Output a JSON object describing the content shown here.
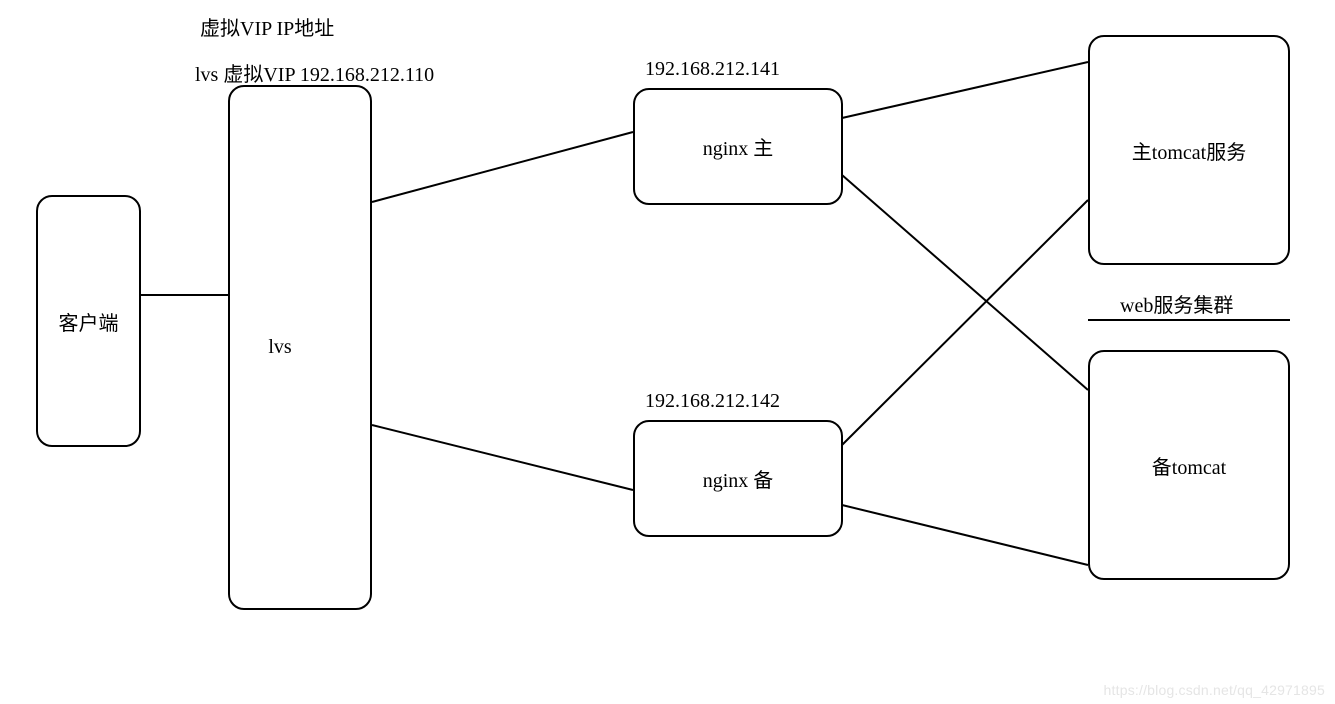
{
  "title_top": "虚拟VIP  IP地址",
  "lvs_vip_label": "lvs 虚拟VIP 192.168.212.110",
  "nodes": {
    "client": "客户端",
    "lvs": "lvs",
    "nginx_master": "nginx 主",
    "nginx_backup": "nginx 备",
    "tomcat_master": "主tomcat服务",
    "tomcat_backup": "备tomcat"
  },
  "ips": {
    "nginx_master": "192.168.212.141",
    "nginx_backup": "192.168.212.142"
  },
  "cluster_label": "web服务集群",
  "watermark": "https://blog.csdn.net/qq_42971895"
}
